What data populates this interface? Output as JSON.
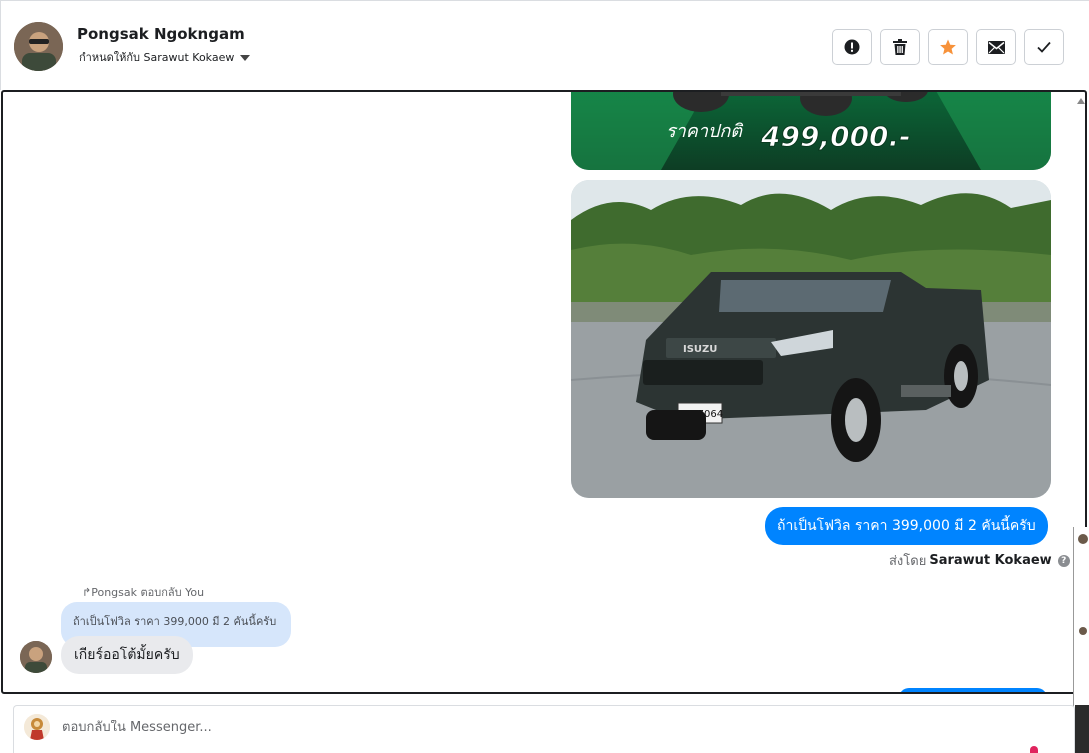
{
  "header": {
    "contact_name": "Pongsak Ngokngam",
    "assigned_label": "กำหนดให้กับ Sarawut Kokaew",
    "actions": [
      {
        "name": "report-button",
        "icon": "alert-circle-icon"
      },
      {
        "name": "delete-button",
        "icon": "trash-icon"
      },
      {
        "name": "star-button",
        "icon": "star-icon"
      },
      {
        "name": "mark-unread-button",
        "icon": "envelope-icon"
      },
      {
        "name": "done-button",
        "icon": "checkmark-icon"
      }
    ]
  },
  "thread": {
    "promo_price_text": "ราคาปกติ 499,000.-",
    "truck_plate": "บล 7064",
    "truck_brand": "ISUZU",
    "outgoing_message": "ถ้าเป็นโฟวิล ราคา 399,000 มี 2 คันนี้ครับ",
    "sent_by_prefix": "ส่งโดย",
    "sent_by_name": "Sarawut Kokaew",
    "reply_note": "Pongsak ตอบกลับ You",
    "quoted_message": "ถ้าเป็นโฟวิล ราคา 399,000 มี 2 คันนี้ครับ",
    "incoming_message": "เกียร์ออโต้มั้ยครับ"
  },
  "composer": {
    "placeholder": "ตอบกลับใน Messenger..."
  },
  "colors": {
    "accent": "#0084ff",
    "star": "#f7923a",
    "promo_green": "#1f9a4f"
  }
}
